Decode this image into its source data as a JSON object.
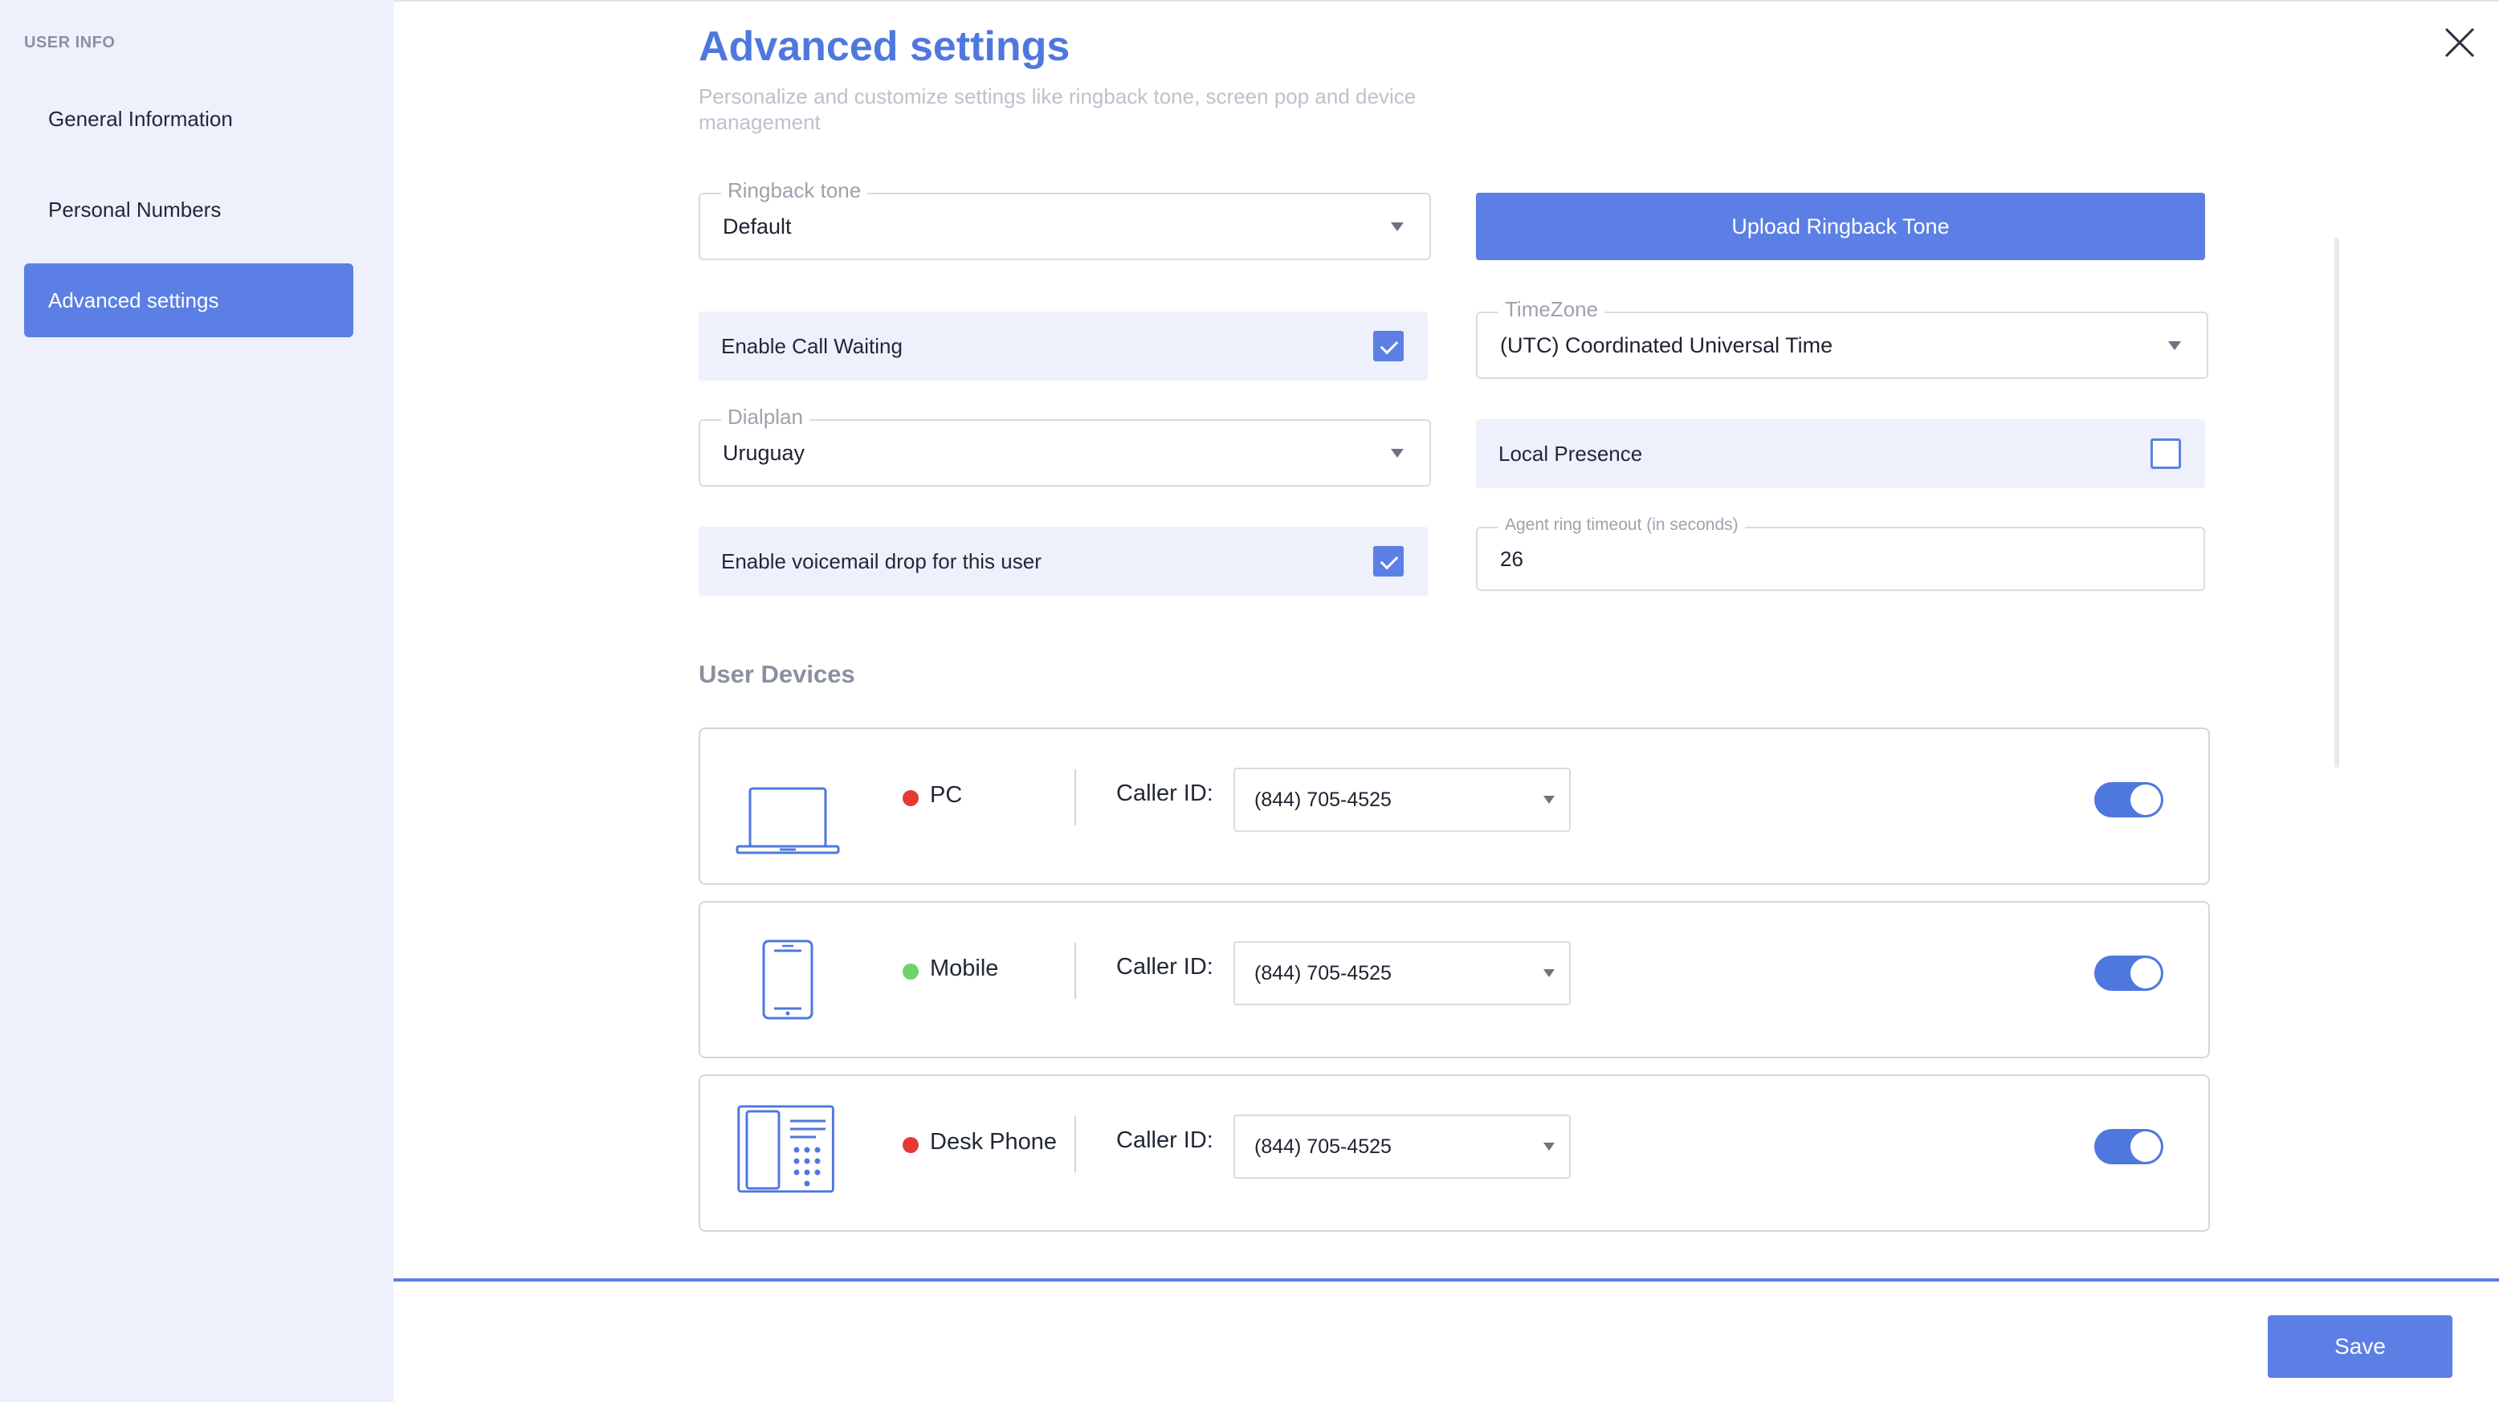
{
  "sidebar": {
    "section": "USER INFO",
    "items": [
      {
        "label": "General Information",
        "active": false
      },
      {
        "label": "Personal Numbers",
        "active": false
      },
      {
        "label": "Advanced settings",
        "active": true
      }
    ]
  },
  "header": {
    "title": "Advanced settings",
    "subtitle": "Personalize and customize settings like ringback tone, screen pop and device management"
  },
  "ringback": {
    "label": "Ringback tone",
    "value": "Default"
  },
  "upload_button": "Upload Ringback Tone",
  "call_waiting": {
    "label": "Enable Call Waiting",
    "checked": true
  },
  "timezone": {
    "label": "TimeZone",
    "value": "(UTC) Coordinated Universal Time"
  },
  "dialplan": {
    "label": "Dialplan",
    "value": "Uruguay"
  },
  "local_presence": {
    "label": "Local Presence",
    "checked": false
  },
  "voicemail_drop": {
    "label": "Enable voicemail drop for this user",
    "checked": true
  },
  "agent_timeout": {
    "label": "Agent ring timeout (in seconds)",
    "value": "26"
  },
  "devices": {
    "title": "User Devices",
    "items": [
      {
        "name": "PC",
        "icon": "laptop-icon",
        "status_color": "#e53935",
        "caller_label": "Caller ID:",
        "caller_id": "(844) 705-4525",
        "enabled": true
      },
      {
        "name": "Mobile",
        "icon": "mobile-phone-icon",
        "status_color": "#6fd36a",
        "caller_label": "Caller ID:",
        "caller_id": "(844) 705-4525",
        "enabled": true
      },
      {
        "name": "Desk Phone",
        "icon": "desk-phone-icon",
        "status_color": "#e53935",
        "caller_label": "Caller ID:",
        "caller_id": "(844) 705-4525",
        "enabled": true
      }
    ]
  },
  "footer": {
    "save_label": "Save"
  },
  "colors": {
    "accent": "#5b7fe4",
    "title": "#4f78de",
    "sidebar_bg": "#eef1fb"
  }
}
